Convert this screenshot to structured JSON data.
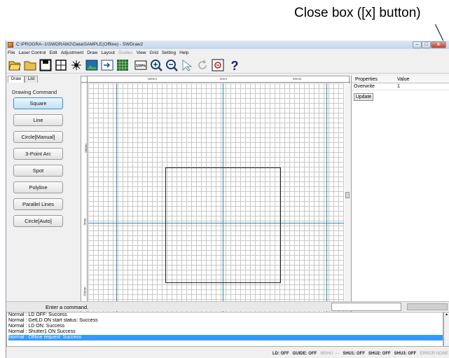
{
  "annotation": {
    "text": "Close box ([x] button)"
  },
  "window": {
    "title": "C:\\PROGRA~1\\SWDRAW2\\Data\\SAMPLE(Offline) - SWDraw2",
    "controls": {
      "minimize": "–",
      "maximize": "□",
      "close": "x"
    }
  },
  "menu": {
    "items": [
      {
        "label": "File",
        "enabled": true
      },
      {
        "label": "Laser Control",
        "enabled": true
      },
      {
        "label": "Edit",
        "enabled": true
      },
      {
        "label": "Adjustment",
        "enabled": true
      },
      {
        "label": "Draw",
        "enabled": true
      },
      {
        "label": "Layout",
        "enabled": true
      },
      {
        "label": "Guides",
        "enabled": false
      },
      {
        "label": "View",
        "enabled": true
      },
      {
        "label": "Grid",
        "enabled": true
      },
      {
        "label": "Setting",
        "enabled": true
      },
      {
        "label": "Help",
        "enabled": true
      }
    ]
  },
  "toolbar": {
    "icons": [
      "open-folder-icon",
      "folder-icon",
      "save-icon",
      "crosshair-box-icon",
      "burst-icon",
      "image-icon",
      "export-icon",
      "grid-icon",
      "zoom-100-icon",
      "zoom-in-icon",
      "zoom-out-icon",
      "pointer-icon",
      "rotate-icon",
      "zoom-fit-icon",
      "help-icon"
    ],
    "zoom_100_label": "100%",
    "help_label": "?"
  },
  "left_panel": {
    "tabs": [
      {
        "label": "Draw",
        "active": true
      },
      {
        "label": "List",
        "active": false
      }
    ],
    "section_title": "Drawing Command",
    "commands": [
      {
        "label": "Square",
        "selected": true
      },
      {
        "label": "Line",
        "selected": false
      },
      {
        "label": "Circle[Manual]",
        "selected": false
      },
      {
        "label": "3-Point Arc",
        "selected": false
      },
      {
        "label": "Spot",
        "selected": false
      },
      {
        "label": "Polyline",
        "selected": false
      },
      {
        "label": "Parallel Lines",
        "selected": false
      },
      {
        "label": "Circle[Auto]",
        "selected": false
      }
    ]
  },
  "canvas": {
    "ruler_top": [
      "-50mm",
      "0mm",
      "50mm"
    ],
    "ruler_left": [
      "50mm",
      "0mm",
      "-50mm"
    ],
    "colors": {
      "guide": "#2f8fa3",
      "grid": "#c8c8c8",
      "shape": "#222222"
    }
  },
  "properties": {
    "headers": {
      "name": "Properties",
      "value": "Value"
    },
    "rows": [
      {
        "name": "Overwrite",
        "value": "1"
      }
    ],
    "update_label": "Update"
  },
  "command_line": {
    "prompt": "Enter a command.",
    "input_value": ""
  },
  "log": {
    "lines": [
      {
        "text": "Normal : LD OFF: Success",
        "selected": false
      },
      {
        "text": "Normal : GetLD ON start status: Success",
        "selected": false
      },
      {
        "text": "Normal : LD ON: Success",
        "selected": false
      },
      {
        "text": "Normal : Shutter1 ON Success",
        "selected": false
      },
      {
        "text": "Normal : Offline request: Success",
        "selected": true
      }
    ],
    "selection_color": "#3399ff"
  },
  "status": {
    "items": [
      {
        "text": "LD: OFF",
        "dim": false
      },
      {
        "text": "GUIDE: OFF",
        "dim": false
      },
      {
        "text": "MSHU: ---",
        "dim": true
      },
      {
        "text": "SHU1: OFF",
        "dim": false
      },
      {
        "text": "SHU2: OFF",
        "dim": false
      },
      {
        "text": "SHU3: OFF",
        "dim": false
      },
      {
        "text": "ERROR NONE",
        "dim": true
      }
    ]
  }
}
